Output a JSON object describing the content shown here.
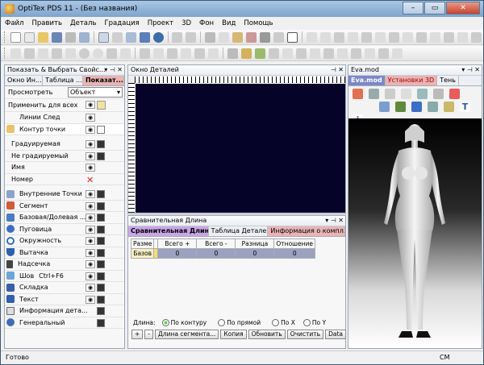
{
  "window": {
    "title": "OptiTex PDS 11 - (Без названия)"
  },
  "menu": [
    "Файл",
    "Править",
    "Деталь",
    "Градация",
    "Проект",
    "3D",
    "Фон",
    "Вид",
    "Помощь"
  ],
  "left_panel": {
    "title": "Показать & Выбрать Свойс...",
    "tabs": [
      "Окно Ин...",
      "Таблица ...",
      "Показат..."
    ],
    "view_label": "Просмотреть",
    "view_value": "Объект",
    "apply_all": "Применить для всех",
    "rows": [
      "Линии След",
      "Контур точки",
      "Градуируемая",
      "Не градируемый",
      "Имя",
      "Номер",
      "Внутренние Точки",
      "Сегмент",
      "Базовая/Долевая ...",
      "Пуговица",
      "Окружность",
      "Вытачка",
      "Надсечка",
      "Шов",
      "Складка",
      "Текст",
      "Информация дета...",
      "Генеральный"
    ],
    "seam_shortcut": "Ctrl+F6"
  },
  "detail_window": {
    "title": "Окно Деталей"
  },
  "compare_panel": {
    "title": "Сравнительная Длина",
    "tabs": [
      "Сравнительная Длина",
      "Таблица Деталей",
      "Информация о компл..."
    ],
    "headers": [
      "Разме",
      "Всего +",
      "Всего -",
      "Разница",
      "Отношение"
    ],
    "row": [
      "Базов",
      "0",
      "0",
      "0",
      "0"
    ],
    "length_label": "Длина:",
    "radios": [
      "По контуру",
      "По прямой",
      "По X",
      "По Y"
    ],
    "buttons": [
      "+",
      "-",
      "Длина сегмента...",
      "Копия",
      "Обновить",
      "Очистить",
      "Data",
      "<<"
    ]
  },
  "model_panel": {
    "title": "Eva.mod",
    "tabs": [
      "Eva.mod",
      "Установки 3D",
      "Тень"
    ]
  },
  "status": {
    "left": "Готово",
    "right": "CM"
  },
  "colors": {
    "detail_bg": "#050428",
    "tab_active": "#c9a6e6",
    "tab_red": "#e8b4b4"
  }
}
